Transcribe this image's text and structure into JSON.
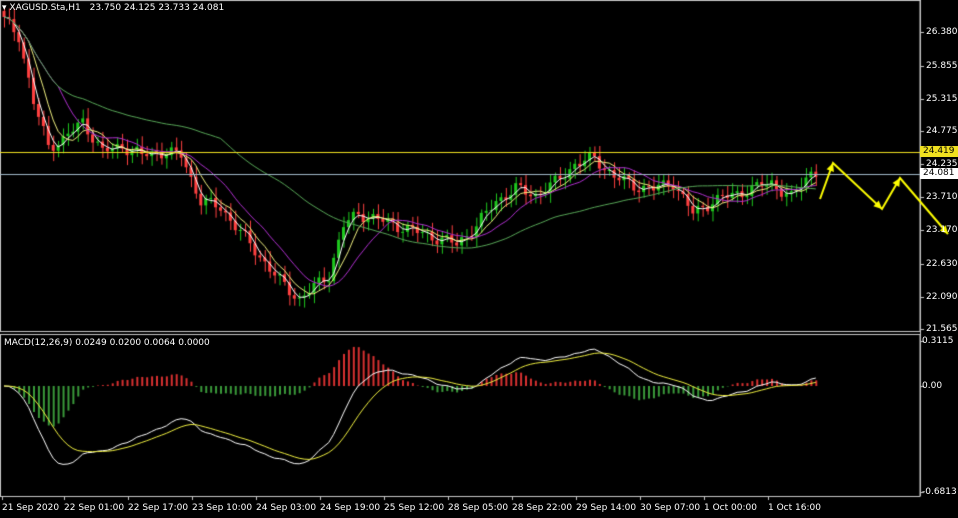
{
  "header": {
    "title": "XAGUSD.Sta,H1",
    "ohlc": "23.750 24.125 23.733 24.081"
  },
  "macd_header": "MACD(12,26,9) 0.0249 0.0200 0.0064 0.0000",
  "price_axis": {
    "ticks": [
      "26.380",
      "25.855",
      "25.315",
      "24.775",
      "24.235",
      "23.710",
      "23.170",
      "22.630",
      "22.090",
      "21.565"
    ],
    "levels": {
      "resistance": {
        "value": 24.419,
        "label": "24.419",
        "color": "#f0e020"
      },
      "last": {
        "value": 24.081,
        "label": "24.081",
        "color": "#a0b8c8"
      }
    }
  },
  "macd_axis": {
    "ticks": [
      "0.3115",
      "0.00",
      "-0.6813"
    ]
  },
  "time_axis": {
    "labels": [
      "21 Sep 2020",
      "22 Sep 01:00",
      "22 Sep 17:00",
      "23 Sep 10:00",
      "24 Sep 03:00",
      "24 Sep 19:00",
      "25 Sep 12:00",
      "28 Sep 05:00",
      "28 Sep 22:00",
      "29 Sep 14:00",
      "30 Sep 07:00",
      "1 Oct 00:00",
      "1 Oct 16:00"
    ]
  },
  "colors": {
    "bull": "#1ec81e",
    "bear": "#ff4040",
    "ma_fast": "#ffffff",
    "ma_mid": "#f0f080",
    "ma_slow": "#b030d0",
    "ma_long": "#58a858",
    "macd_hist_up": "#d83030",
    "macd_hist_down": "#3a9a3a",
    "macd_line": "#ffffff",
    "signal_line": "#f0f040",
    "projection": "#ffff00"
  },
  "chart_data": {
    "type": "candlestick",
    "symbol": "XAGUSD.Sta",
    "timeframe": "H1",
    "close_path": [
      [
        0,
        26.55
      ],
      [
        3,
        26.3
      ],
      [
        6,
        25.2
      ],
      [
        9,
        24.5
      ],
      [
        12,
        24.6
      ],
      [
        16,
        24.9
      ],
      [
        20,
        24.4
      ],
      [
        24,
        24.5
      ],
      [
        28,
        24.35
      ],
      [
        32,
        24.4
      ],
      [
        36,
        24.35
      ],
      [
        40,
        23.6
      ],
      [
        44,
        23.5
      ],
      [
        48,
        23.1
      ],
      [
        52,
        22.7
      ],
      [
        56,
        22.3
      ],
      [
        60,
        22.0
      ],
      [
        63,
        22.2
      ],
      [
        66,
        22.4
      ],
      [
        69,
        23.2
      ],
      [
        72,
        23.4
      ],
      [
        76,
        23.3
      ],
      [
        80,
        23.2
      ],
      [
        84,
        23.1
      ],
      [
        88,
        23.0
      ],
      [
        92,
        22.9
      ],
      [
        96,
        23.2
      ],
      [
        100,
        23.6
      ],
      [
        104,
        23.8
      ],
      [
        108,
        23.7
      ],
      [
        112,
        23.9
      ],
      [
        116,
        24.2
      ],
      [
        120,
        24.3
      ],
      [
        124,
        24.0
      ],
      [
        128,
        23.85
      ],
      [
        132,
        23.8
      ],
      [
        136,
        23.9
      ],
      [
        140,
        23.4
      ],
      [
        144,
        23.6
      ],
      [
        148,
        23.7
      ],
      [
        152,
        23.8
      ],
      [
        156,
        23.9
      ],
      [
        160,
        23.65
      ],
      [
        164,
        24.08
      ]
    ],
    "projection": [
      [
        24.081,
        0
      ],
      [
        24.3,
        1
      ],
      [
        23.6,
        2
      ],
      [
        24.1,
        3
      ],
      [
        23.3,
        4
      ]
    ],
    "macd_range": [
      -0.6813,
      0.3115
    ]
  }
}
